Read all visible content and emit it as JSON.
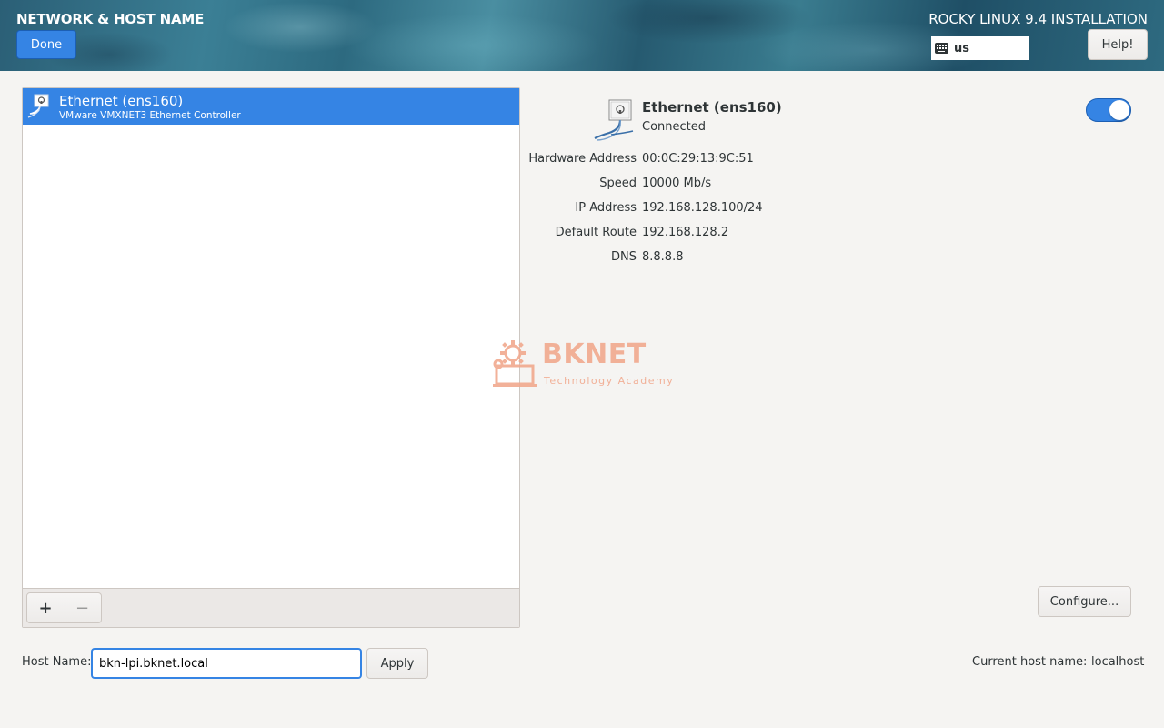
{
  "header": {
    "title": "NETWORK & HOST NAME",
    "done_label": "Done",
    "installation_title": "ROCKY LINUX 9.4 INSTALLATION",
    "keyboard_layout": "us",
    "help_label": "Help!"
  },
  "device_list": {
    "items": [
      {
        "name": "Ethernet (ens160)",
        "description": "VMware VMXNET3 Ethernet Controller",
        "selected": true
      }
    ],
    "add_label": "+",
    "remove_label": "−"
  },
  "details": {
    "name": "Ethernet (ens160)",
    "status": "Connected",
    "enabled": true,
    "properties": [
      {
        "label": "Hardware Address",
        "value": "00:0C:29:13:9C:51"
      },
      {
        "label": "Speed",
        "value": "10000 Mb/s"
      },
      {
        "label": "IP Address",
        "value": "192.168.128.100/24"
      },
      {
        "label": "Default Route",
        "value": "192.168.128.2"
      },
      {
        "label": "DNS",
        "value": "8.8.8.8"
      }
    ],
    "configure_label": "Configure..."
  },
  "hostname": {
    "label": "Host Name:",
    "value": "bkn-lpi.bknet.local",
    "apply_label": "Apply",
    "current_label": "Current host name:",
    "current_value": "localhost"
  },
  "watermark": {
    "brand": "BKNET",
    "tagline": "Technology Academy"
  },
  "colors": {
    "accent": "#3584e4",
    "watermark": "#f1a98e"
  }
}
